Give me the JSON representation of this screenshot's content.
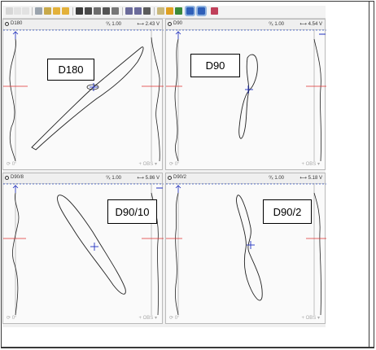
{
  "panels": [
    {
      "id": "tl",
      "title": "D180",
      "scale": "1.00",
      "voltage": "2.43 V",
      "angle": "0°",
      "obs": "OBS",
      "label": "D180"
    },
    {
      "id": "tr",
      "title": "D90",
      "scale": "1.00",
      "voltage": "4.54 V",
      "angle": "0°",
      "obs": "OBS",
      "label": "D90"
    },
    {
      "id": "bl",
      "title": "D90/8",
      "scale": "1.00",
      "voltage": "5.86 V",
      "angle": "0°",
      "obs": "OBS",
      "label": "D90/10"
    },
    {
      "id": "br",
      "title": "D90/2",
      "scale": "1.00",
      "voltage": "5.18 V",
      "angle": "0°",
      "obs": "OBS",
      "label": "D90/2"
    }
  ],
  "toolbar_icons": [
    "pointer-icon",
    "undo-icon",
    "redo-icon",
    "chart-icon",
    "properties-icon",
    "arrow-left-icon",
    "arrow-right-icon",
    "save-icon",
    "print-icon",
    "document-icon",
    "checkbox-icon",
    "window-icon",
    "zoom-in-icon",
    "zoom-out-icon",
    "cursor-icon",
    "highlighter-icon",
    "palette-icon",
    "bar-icon",
    "grid-blue-icon",
    "grid-blue2-icon",
    "stack-icon"
  ],
  "colors": {
    "trace": "#222222",
    "marker_red": "#e03030",
    "marker_blue": "#2030c0",
    "selected_tool": "#8fb3e0"
  }
}
